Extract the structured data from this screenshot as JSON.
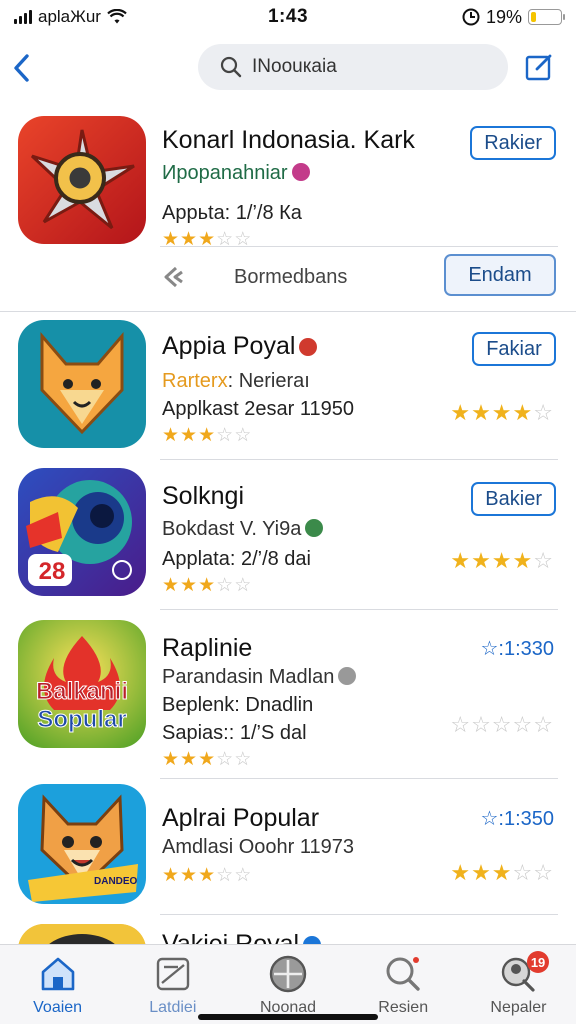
{
  "status_bar": {
    "carrier": "aplaЖur",
    "time": "1:43",
    "battery": "19%",
    "battery_level": 0.19
  },
  "nav": {
    "search_text": "INoouкаіа"
  },
  "apps": [
    {
      "title": "Konarl  Indonasia. Kark",
      "subtitle": "Ирораnahniar",
      "meta": "Appьtа: 1/’/8 Ка",
      "rating": 3.5,
      "button": "Rakier",
      "secondary_text": "Bormedbans",
      "secondary_button": "Endam"
    },
    {
      "title": "Appia Poyal",
      "subtitle_highlight": "Rarterx",
      "subtitle": ": Nerierаı",
      "meta": "Applkast  2esar 11950",
      "rating": 3.5,
      "right_rating": 4,
      "button": "Fakiar"
    },
    {
      "title": "Solkngi",
      "subtitle": "Bokdast V. Yi9a",
      "meta": "Applata: 2/’/8 dai",
      "rating": 3.5,
      "right_rating": 4,
      "button": "Bakier"
    },
    {
      "title": "Raplinie",
      "subtitle": "Parandasin Madlan",
      "meta": "Beplenk: Dnadlin",
      "meta2": "Sapias:: 1/’S dal",
      "rating": 3.5,
      "right_rating": 0,
      "price": "☆:1:330",
      "icon_text_1": "Balkanii",
      "icon_text_2": "Sopular"
    },
    {
      "title": "Aplrai Popular",
      "subtitle": "Amdlasi Ooohr 11973",
      "rating": 3.5,
      "right_rating": 3,
      "price": "☆:1:350",
      "icon_tag": "DANDEO"
    },
    {
      "title": "Vakiei Royal"
    }
  ],
  "icon_badge_number": "28",
  "tabs": [
    {
      "label": "Voaien",
      "icon": "home-icon",
      "active": true
    },
    {
      "label": "Latdiei",
      "icon": "apps-icon",
      "active": false
    },
    {
      "label": "Noonad",
      "icon": "compass-icon",
      "active": false
    },
    {
      "label": "Resien",
      "icon": "search-icon",
      "active": false
    },
    {
      "label": "Nepaler",
      "icon": "account-icon",
      "active": false,
      "badge": "19"
    }
  ],
  "colors": {
    "accent": "#1b66c7",
    "star": "#f0a81c",
    "badge": "#e23b2e"
  }
}
